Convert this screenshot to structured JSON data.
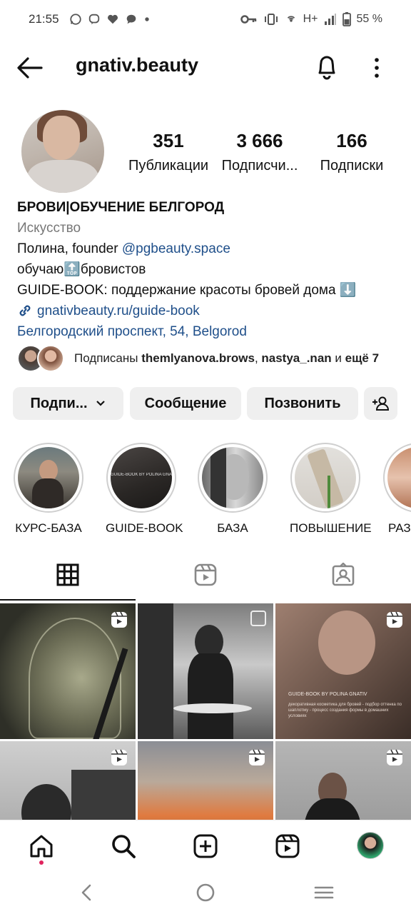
{
  "status_bar": {
    "time": "21:55",
    "network": "H+",
    "battery": "55 %"
  },
  "header": {
    "username": "gnativ.beauty"
  },
  "profile": {
    "stats": [
      {
        "value": "351",
        "label": "Публикации"
      },
      {
        "value": "3 666",
        "label": "Подписчи..."
      },
      {
        "value": "166",
        "label": "Подписки"
      }
    ],
    "name": "БРОВИ|ОБУЧЕНИЕ БЕЛГОРОД",
    "category": "Искусство",
    "bio_line1_prefix": "Полина, founder ",
    "bio_line1_mention": "@pgbeauty.space",
    "bio_line2_prefix": "обучаю",
    "bio_line2_emoji": "🔝",
    "bio_line2_suffix": "бровистов",
    "bio_line3": "GUIDE-BOOK: поддержание красоты бровей дома ⬇️",
    "website": "gnativbeauty.ru/guide-book",
    "address": "Белгородский проспект, 54, Belgorod"
  },
  "followed_by": {
    "prefix": "Подписаны ",
    "user1": "themlyanova.brows",
    "separator": ", ",
    "user2": "nastya_.nan",
    "middle": " и ",
    "suffix": "ещё 7"
  },
  "actions": {
    "follow_label": "Подпи...",
    "message_label": "Сообщение",
    "call_label": "Позвонить"
  },
  "highlights": [
    {
      "label": "КУРС-БАЗА"
    },
    {
      "label": "GUIDE-BOOK"
    },
    {
      "label": "БАЗА"
    },
    {
      "label": "ПОВЫШЕНИЕ"
    },
    {
      "label": "РАЗ"
    }
  ],
  "highlight_texts": {
    "guidebook_title": "GUIDE-BOOK BY POLINA GNATIV"
  },
  "grid_texts": {
    "tile3_title": "GUIDE-BOOK BY POLINA GNATIV",
    "tile3_sub": "декоративная косметика для бровей - подбор оттенка по шаплотму - процесс создания формы в домашних условиях"
  },
  "colors": {
    "link": "#1f4f8a",
    "button_bg": "#efefef",
    "notification_dot": "#e0245e"
  }
}
